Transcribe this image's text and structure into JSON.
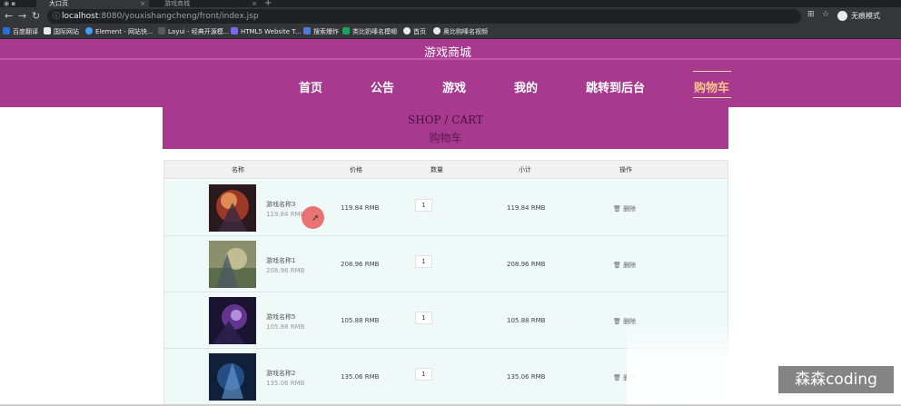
{
  "browser": {
    "tabs": [
      {
        "label": "大口页",
        "active": true
      },
      {
        "label": "游戏商城",
        "active": false
      }
    ],
    "tab_close": "×",
    "new_tab": "+",
    "url_host": "localhost",
    "url_path": ":8080/youxishangcheng/front/index.jsp",
    "incognito_label": "无痕模式",
    "bookmarks": [
      "百度翻译",
      "国际网站",
      "Element - 网站快...",
      "Layui - 经典开源模...",
      "HTML5 Website T...",
      "搜索爆炸",
      "类比奶嗪名模唧",
      "首页",
      "奥比购嗪名视频"
    ]
  },
  "site": {
    "title": "游戏商城",
    "menu": [
      "首页",
      "公告",
      "游戏",
      "我的",
      "跳转到后台",
      "购物车"
    ],
    "active_menu": "购物车"
  },
  "banner": {
    "en": "SHOP / CART",
    "zh": "购物车"
  },
  "table": {
    "headers": [
      "名称",
      "价格",
      "数量",
      "小计",
      "操作"
    ],
    "rows": [
      {
        "name": "游戏名称3",
        "price": "119.84 RMB",
        "qty": "1",
        "subtotal": "119.84 RMB",
        "action": "删除"
      },
      {
        "name": "游戏名称1",
        "price": "208.96 RMB",
        "qty": "1",
        "subtotal": "208.96 RMB",
        "action": "删除"
      },
      {
        "name": "游戏名称5",
        "price": "105.88 RMB",
        "qty": "1",
        "subtotal": "105.88 RMB",
        "action": "删除"
      },
      {
        "name": "游戏名称2",
        "price": "135.06 RMB",
        "qty": "1",
        "subtotal": "135.06 RMB",
        "action": "删除"
      }
    ]
  },
  "watermark": "森森coding",
  "colors": {
    "header_bg": "#a7398f",
    "active_menu": "#f7c38a",
    "row_bg": "#eef9f8"
  }
}
